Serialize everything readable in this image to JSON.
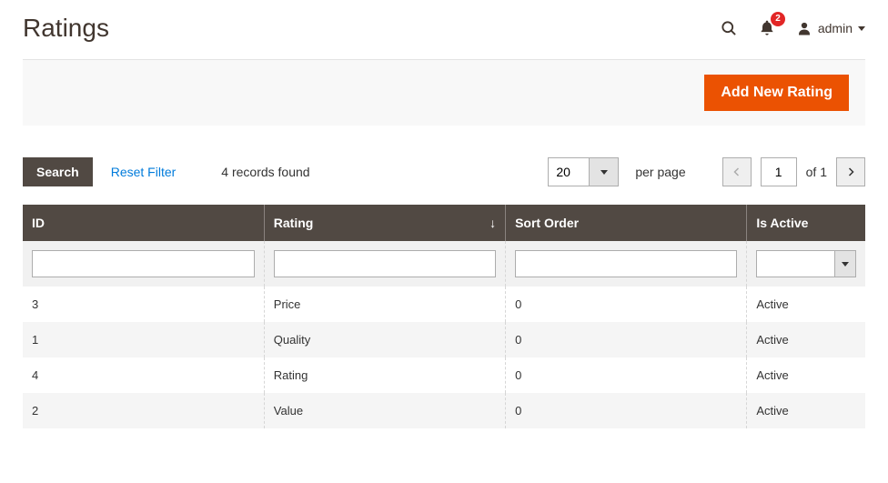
{
  "header": {
    "title": "Ratings",
    "notification_count": "2",
    "admin_username": "admin"
  },
  "actions": {
    "add_new_rating": "Add New Rating"
  },
  "toolbar": {
    "search_label": "Search",
    "reset_label": "Reset Filter",
    "records_found": "4 records found",
    "page_size_value": "20",
    "per_page_label": "per page",
    "current_page": "1",
    "total_pages": "1",
    "of_label": "of"
  },
  "grid": {
    "columns": {
      "id": "ID",
      "rating": "Rating",
      "sort_order": "Sort Order",
      "is_active": "Is Active"
    },
    "rows": [
      {
        "id": "3",
        "rating": "Price",
        "sort_order": "0",
        "is_active": "Active"
      },
      {
        "id": "1",
        "rating": "Quality",
        "sort_order": "0",
        "is_active": "Active"
      },
      {
        "id": "4",
        "rating": "Rating",
        "sort_order": "0",
        "is_active": "Active"
      },
      {
        "id": "2",
        "rating": "Value",
        "sort_order": "0",
        "is_active": "Active"
      }
    ]
  }
}
